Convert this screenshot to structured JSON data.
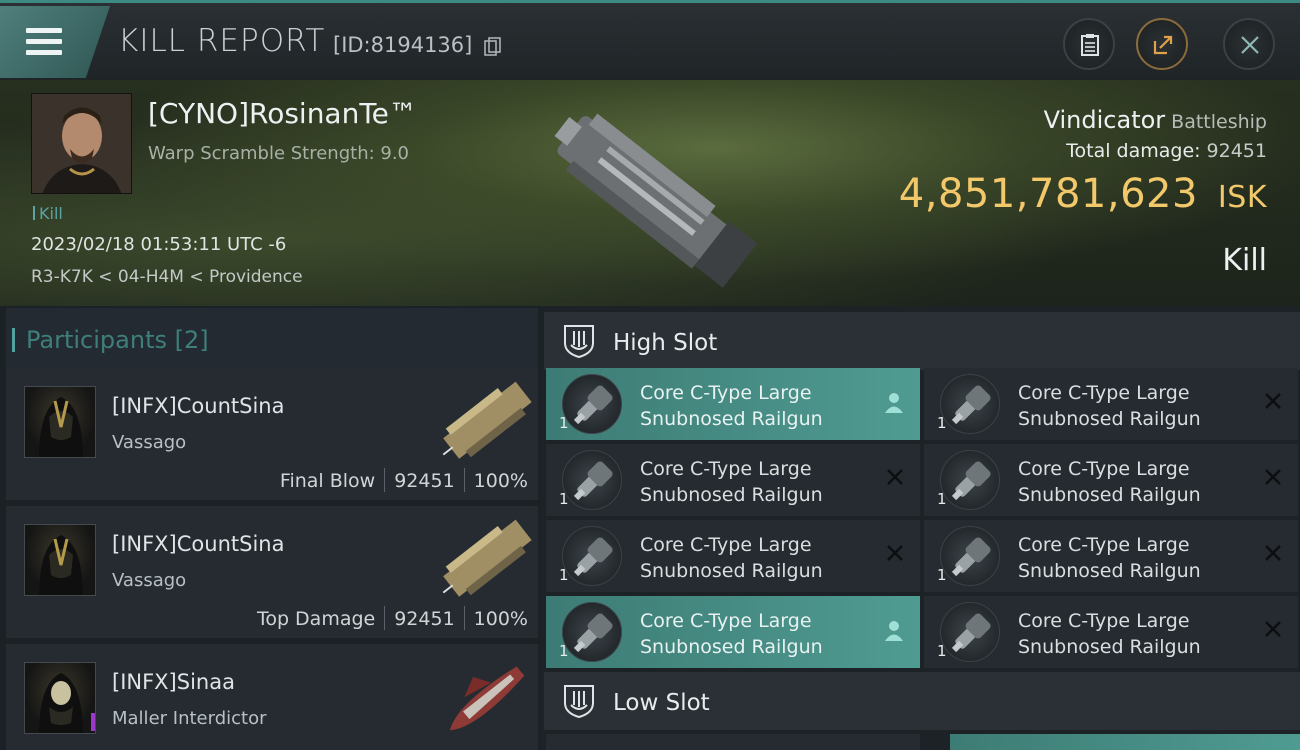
{
  "header": {
    "title": "KILL REPORT",
    "report_id": "[ID:8194136]"
  },
  "victim": {
    "name": "[CYNO]RosinanTe™",
    "warp_scramble": "Warp Scramble Strength: 9.0",
    "tag": "Kill",
    "datetime": "2023/02/18 01:53:11 UTC -6",
    "location": "R3-K7K < 04-H4M < Providence",
    "ship_name": "Vindicator",
    "ship_class": "Battleship",
    "total_damage_label": "Total damage:",
    "total_damage": "92451",
    "isk_value": "4,851,781,623",
    "isk_unit": "ISK",
    "result": "Kill"
  },
  "participants": {
    "label": "Participants [2]",
    "items": [
      {
        "name": "[INFX]CountSina",
        "ship": "Vassago",
        "role": "Final Blow",
        "damage": "92451",
        "percent": "100%"
      },
      {
        "name": "[INFX]CountSina",
        "ship": "Vassago",
        "role": "Top Damage",
        "damage": "92451",
        "percent": "100%"
      },
      {
        "name": "[INFX]Sinaa",
        "ship": "Maller Interdictor",
        "badge": "i"
      }
    ]
  },
  "slots": {
    "high_label": "High Slot",
    "low_label": "Low Slot",
    "high": [
      {
        "line1": "Core C-Type Large",
        "line2": "Snubnosed Railgun",
        "qty": "1",
        "status": "dropped"
      },
      {
        "line1": "Core C-Type Large",
        "line2": "Snubnosed Railgun",
        "qty": "1",
        "status": "destroyed"
      },
      {
        "line1": "Core C-Type Large",
        "line2": "Snubnosed Railgun",
        "qty": "1",
        "status": "destroyed"
      },
      {
        "line1": "Core C-Type Large",
        "line2": "Snubnosed Railgun",
        "qty": "1",
        "status": "destroyed"
      },
      {
        "line1": "Core C-Type Large",
        "line2": "Snubnosed Railgun",
        "qty": "1",
        "status": "destroyed"
      },
      {
        "line1": "Core C-Type Large",
        "line2": "Snubnosed Railgun",
        "qty": "1",
        "status": "destroyed"
      },
      {
        "line1": "Core C-Type Large",
        "line2": "Snubnosed Railgun",
        "qty": "1",
        "status": "dropped"
      },
      {
        "line1": "Core C-Type Large",
        "line2": "Snubnosed Railgun",
        "qty": "1",
        "status": "destroyed"
      }
    ]
  },
  "colors": {
    "accent": "#4f9b92",
    "isk": "#f2c86a"
  }
}
